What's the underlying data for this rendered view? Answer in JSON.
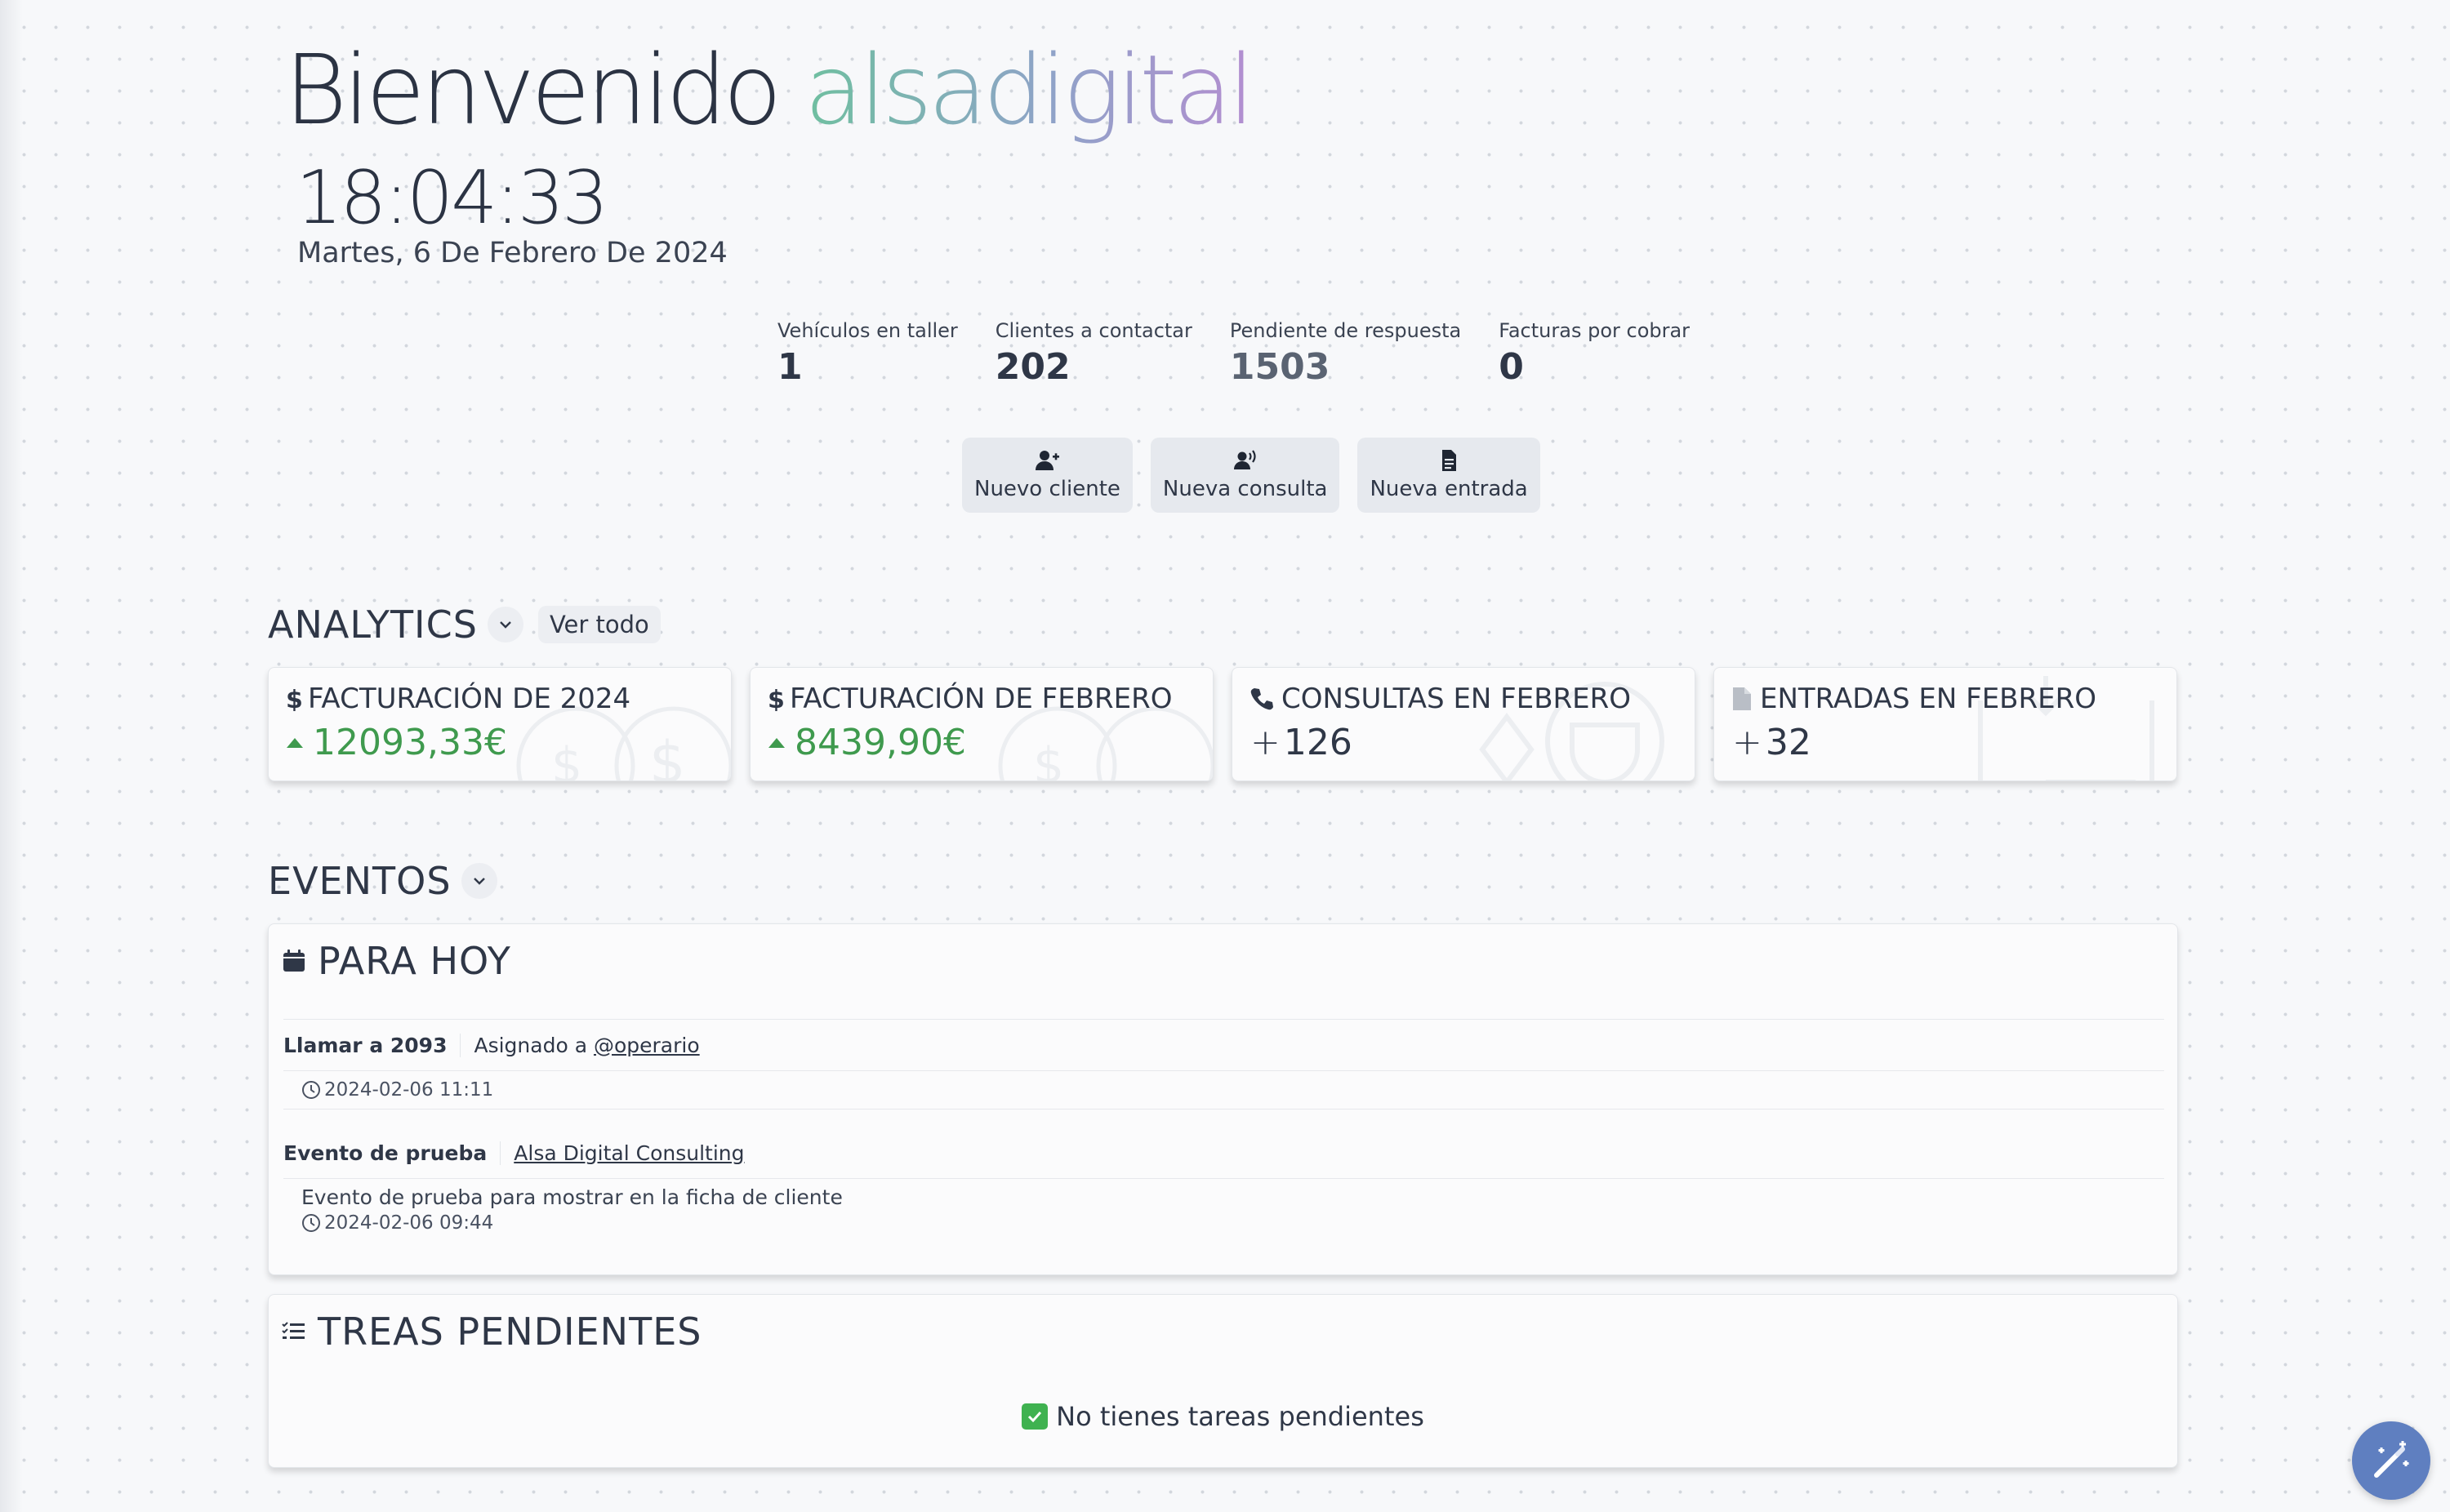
{
  "header": {
    "welcome_text": "Bienvenido",
    "brand_name": "alsadigital",
    "clock": "18:04:33",
    "date": "Martes, 6 De Febrero De 2024"
  },
  "stats": [
    {
      "label": "Vehículos en taller",
      "value": "1"
    },
    {
      "label": "Clientes a contactar",
      "value": "202"
    },
    {
      "label": "Pendiente de respuesta",
      "value": "1503"
    },
    {
      "label": "Facturas por cobrar",
      "value": "0"
    }
  ],
  "actions": [
    {
      "label": "Nuevo cliente",
      "icon": "user-plus-icon"
    },
    {
      "label": "Nueva consulta",
      "icon": "speaking-user-icon"
    },
    {
      "label": "Nueva entrada",
      "icon": "document-icon"
    }
  ],
  "analytics": {
    "title": "ANALYTICS",
    "view_all": "Ver todo",
    "cards": [
      {
        "title": "FACTURACIÓN DE 2024",
        "value": "12093,33€",
        "icon": "dollar-icon",
        "trend": "up"
      },
      {
        "title": "FACTURACIÓN DE FEBRERO",
        "value": "8439,90€",
        "icon": "dollar-icon",
        "trend": "up"
      },
      {
        "title": "CONSULTAS EN FEBRERO",
        "value": "126",
        "prefix": "+",
        "icon": "phone-icon"
      },
      {
        "title": "ENTRADAS EN FEBRERO",
        "value": "32",
        "prefix": "+",
        "icon": "file-icon"
      }
    ]
  },
  "events": {
    "title": "EVENTOS",
    "today": {
      "title": "PARA HOY",
      "items": [
        {
          "name": "Llamar a 2093",
          "assigned_prefix": "Asignado a",
          "assigned_to": "@operario",
          "time": "2024-02-06 11:11"
        },
        {
          "name": "Evento de prueba",
          "client": "Alsa Digital Consulting",
          "description": "Evento de prueba para mostrar en la ficha de cliente",
          "time": "2024-02-06 09:44"
        }
      ]
    },
    "tasks": {
      "title": "TREAS PENDIENTES",
      "empty_message": "No tienes tareas pendientes"
    }
  },
  "colors": {
    "accent_green": "#3f9a4e",
    "brand_gradient_start": "#6fbfa0",
    "brand_gradient_end": "#b38ed0",
    "fab": "#5f7fc0"
  }
}
